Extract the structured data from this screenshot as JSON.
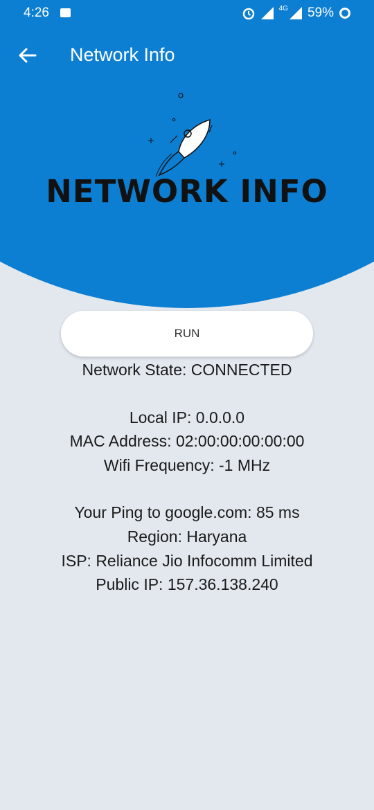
{
  "status_bar": {
    "time": "4:26",
    "network_type": "4G",
    "battery": "59%"
  },
  "header": {
    "title": "Network Info"
  },
  "hero": {
    "logo_text": "NETWORK INFO"
  },
  "button": {
    "run_label": "RUN"
  },
  "info": {
    "network_state": "Network State: CONNECTED",
    "local_ip": "Local IP: 0.0.0.0",
    "mac_address": "MAC Address: 02:00:00:00:00:00",
    "wifi_frequency": "Wifi Frequency: -1 MHz",
    "ping": "Your Ping to google.com: 85 ms",
    "region": "Region: Haryana",
    "isp": "ISP: Reliance Jio Infocomm Limited",
    "public_ip": "Public IP: 157.36.138.240"
  },
  "colors": {
    "primary": "#0d7fd2",
    "background": "#e3e8ef",
    "text": "#1a1a1a"
  },
  "icons": [
    "gallery-icon",
    "alarm-icon",
    "signal-icon",
    "battery-icon",
    "back-arrow-icon",
    "rocket-icon"
  ]
}
